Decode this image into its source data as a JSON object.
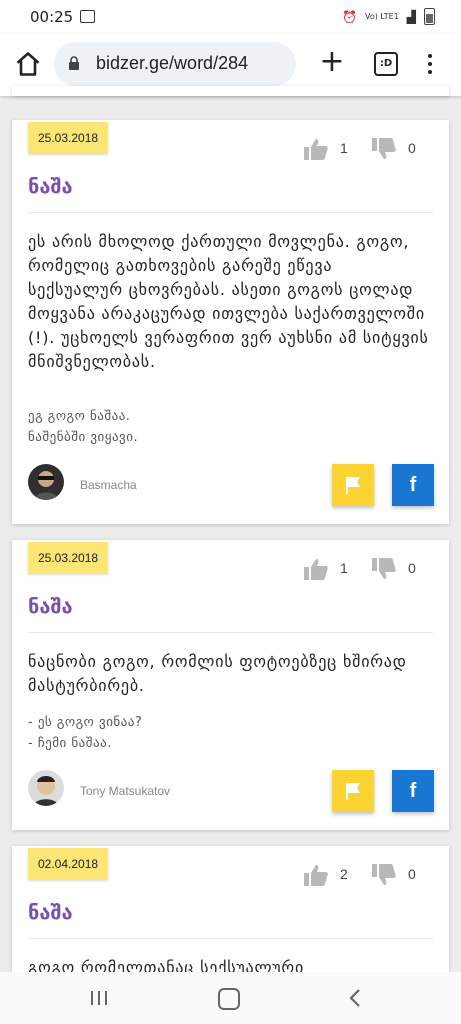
{
  "status": {
    "time": "00:25",
    "net": "Vo) LTE1"
  },
  "browser": {
    "url": "bidzer.ge/word/284",
    "tabs_label": ":D"
  },
  "cards": [
    {
      "date": "25.03.2018",
      "likes": "1",
      "dislikes": "0",
      "word": "ნაშა",
      "definition": "ეს არის მხოლოდ ქართული მოვლენა. გოგო, რომელიც გათხოვების გარეშე ეწევა სექსუალურ ცხოვრებას. ასეთი გოგოს ცოლად მოყვანა არაკაცურად ითვლება საქართველოში (!). უცხოელს ვერაფრით ვერ აუხსნი ამ სიტყვის მნიშვნელობას.",
      "example": "ეგ გოგო ნაშაა.\nნაშენბში ვიყავი.",
      "author": "Basmacha"
    },
    {
      "date": "25.03.2018",
      "likes": "1",
      "dislikes": "0",
      "word": "ნაშა",
      "definition": "ნაცნობი გოგო, რომლის ფოტოებზეც ხშირად მასტურბირებ.",
      "example": "- ეს გოგო ვინაა?\n- ჩემი ნაშაა.",
      "author": "Tony Matsukatov"
    },
    {
      "date": "02.04.2018",
      "likes": "2",
      "dislikes": "0",
      "word": "ნაშა",
      "definition": "გოგო რომელთანაც სექსუალური"
    }
  ],
  "icons": {
    "like": "thumbs-up-icon",
    "dislike": "thumbs-down-icon",
    "flag": "flag-icon",
    "share": "facebook-icon"
  },
  "colors": {
    "word": "#7b4fb0",
    "date_bg": "#fbe675",
    "flag_bg": "#fbd433",
    "fb_bg": "#1976d2"
  }
}
